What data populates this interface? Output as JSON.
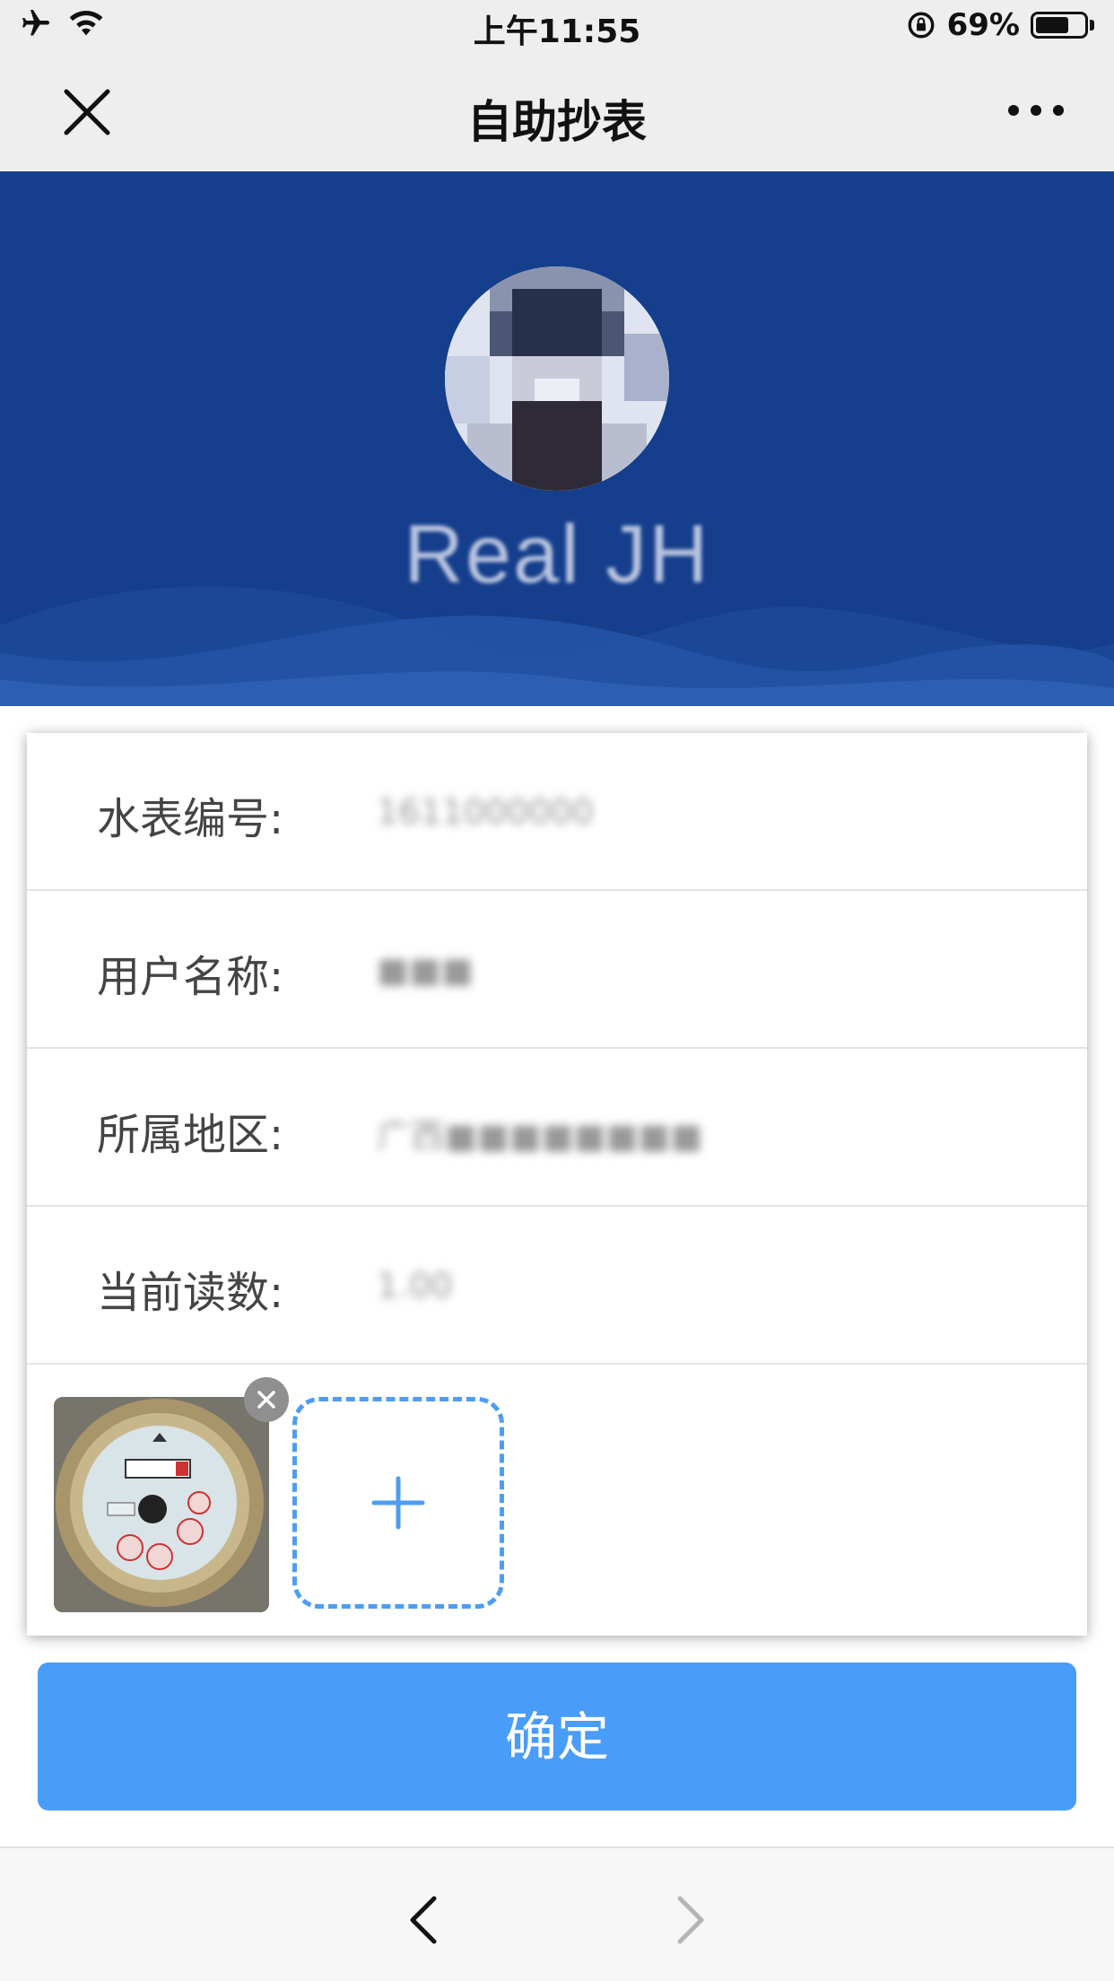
{
  "status_bar": {
    "time": "上午11:55",
    "battery_percent": "69%",
    "battery_level": 0.69,
    "icons": [
      "airplane-icon",
      "wifi-icon",
      "orientation-lock-icon",
      "battery-icon"
    ]
  },
  "nav": {
    "title": "自助抄表",
    "icons": [
      "close-icon",
      "more-icon"
    ]
  },
  "profile": {
    "name": "Real JH"
  },
  "form": {
    "rows": [
      {
        "label": "水表编号:",
        "value": "1611000000"
      },
      {
        "label": "用户名称:",
        "value": "■■■"
      },
      {
        "label": "所属地区:",
        "value": "广西■■■■■■■■"
      },
      {
        "label": "当前读数:",
        "value": "1.00"
      }
    ],
    "photo_icons": [
      "water-meter-photo",
      "remove-icon",
      "plus-icon"
    ]
  },
  "confirm_label": "确定",
  "toolbar": {
    "icons": [
      "chevron-left-icon",
      "chevron-right-icon"
    ]
  },
  "colors": {
    "header_bg": "#153e8c",
    "accent": "#4a9cf9",
    "nav_bg": "#eeeeee"
  }
}
